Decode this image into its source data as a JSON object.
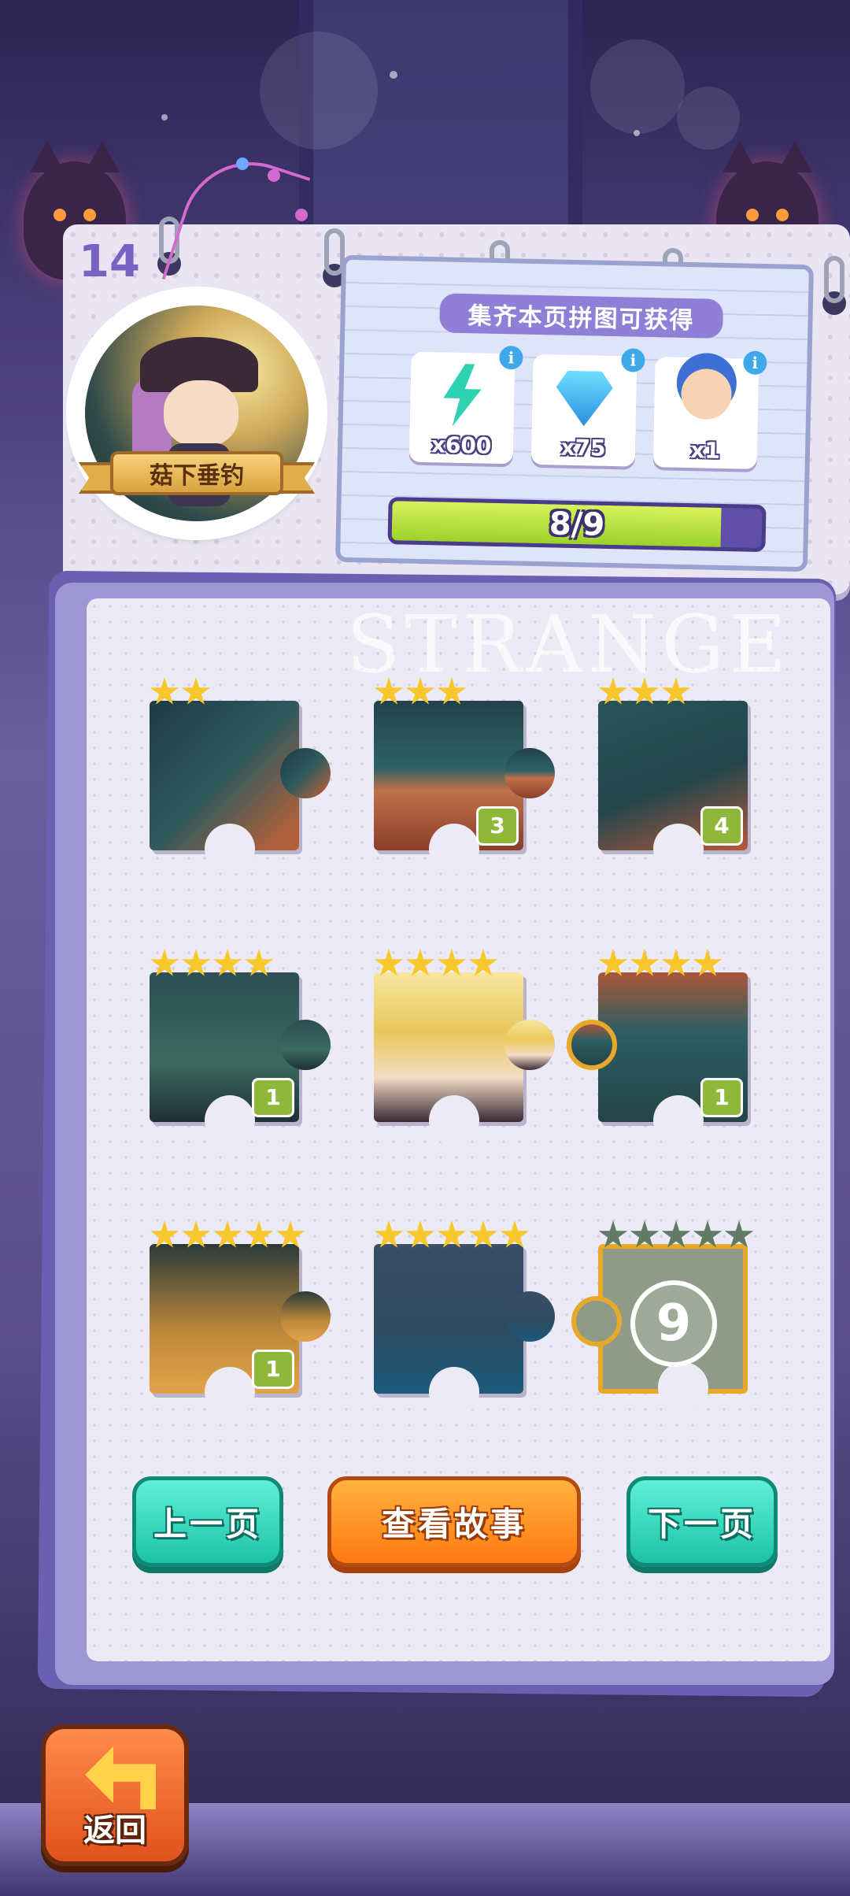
{
  "album": {
    "page_number": "14",
    "badge_title": "菇下垂钓"
  },
  "reward": {
    "title": "集齐本页拼图可获得",
    "items": [
      {
        "icon": "energy-bolt-icon",
        "amount": "x600"
      },
      {
        "icon": "diamond-icon",
        "amount": "x75"
      },
      {
        "icon": "clown-character-icon",
        "amount": "x1"
      }
    ],
    "progress_text": "8/9",
    "progress_fraction": 0.889,
    "info_glyph": "i"
  },
  "watermark": "STRANGE",
  "pieces": [
    {
      "stars": 2,
      "count": ""
    },
    {
      "stars": 3,
      "count": "3"
    },
    {
      "stars": 3,
      "count": "4"
    },
    {
      "stars": 4,
      "count": "1"
    },
    {
      "stars": 4,
      "count": ""
    },
    {
      "stars": 4,
      "count": "1"
    },
    {
      "stars": 5,
      "count": "1"
    },
    {
      "stars": 5,
      "count": ""
    },
    {
      "stars": 5,
      "count": "",
      "locked_number": "9"
    }
  ],
  "buttons": {
    "prev": "上一页",
    "story": "查看故事",
    "next": "下一页",
    "back": "返回"
  },
  "colors": {
    "accent_purple": "#8f7fd6",
    "progress_green": "#9bd22a",
    "star_gold": "#f7c72b",
    "count_green": "#8fb83a",
    "teal_button": "#1cc3a8",
    "orange_button": "#ff7a12"
  }
}
